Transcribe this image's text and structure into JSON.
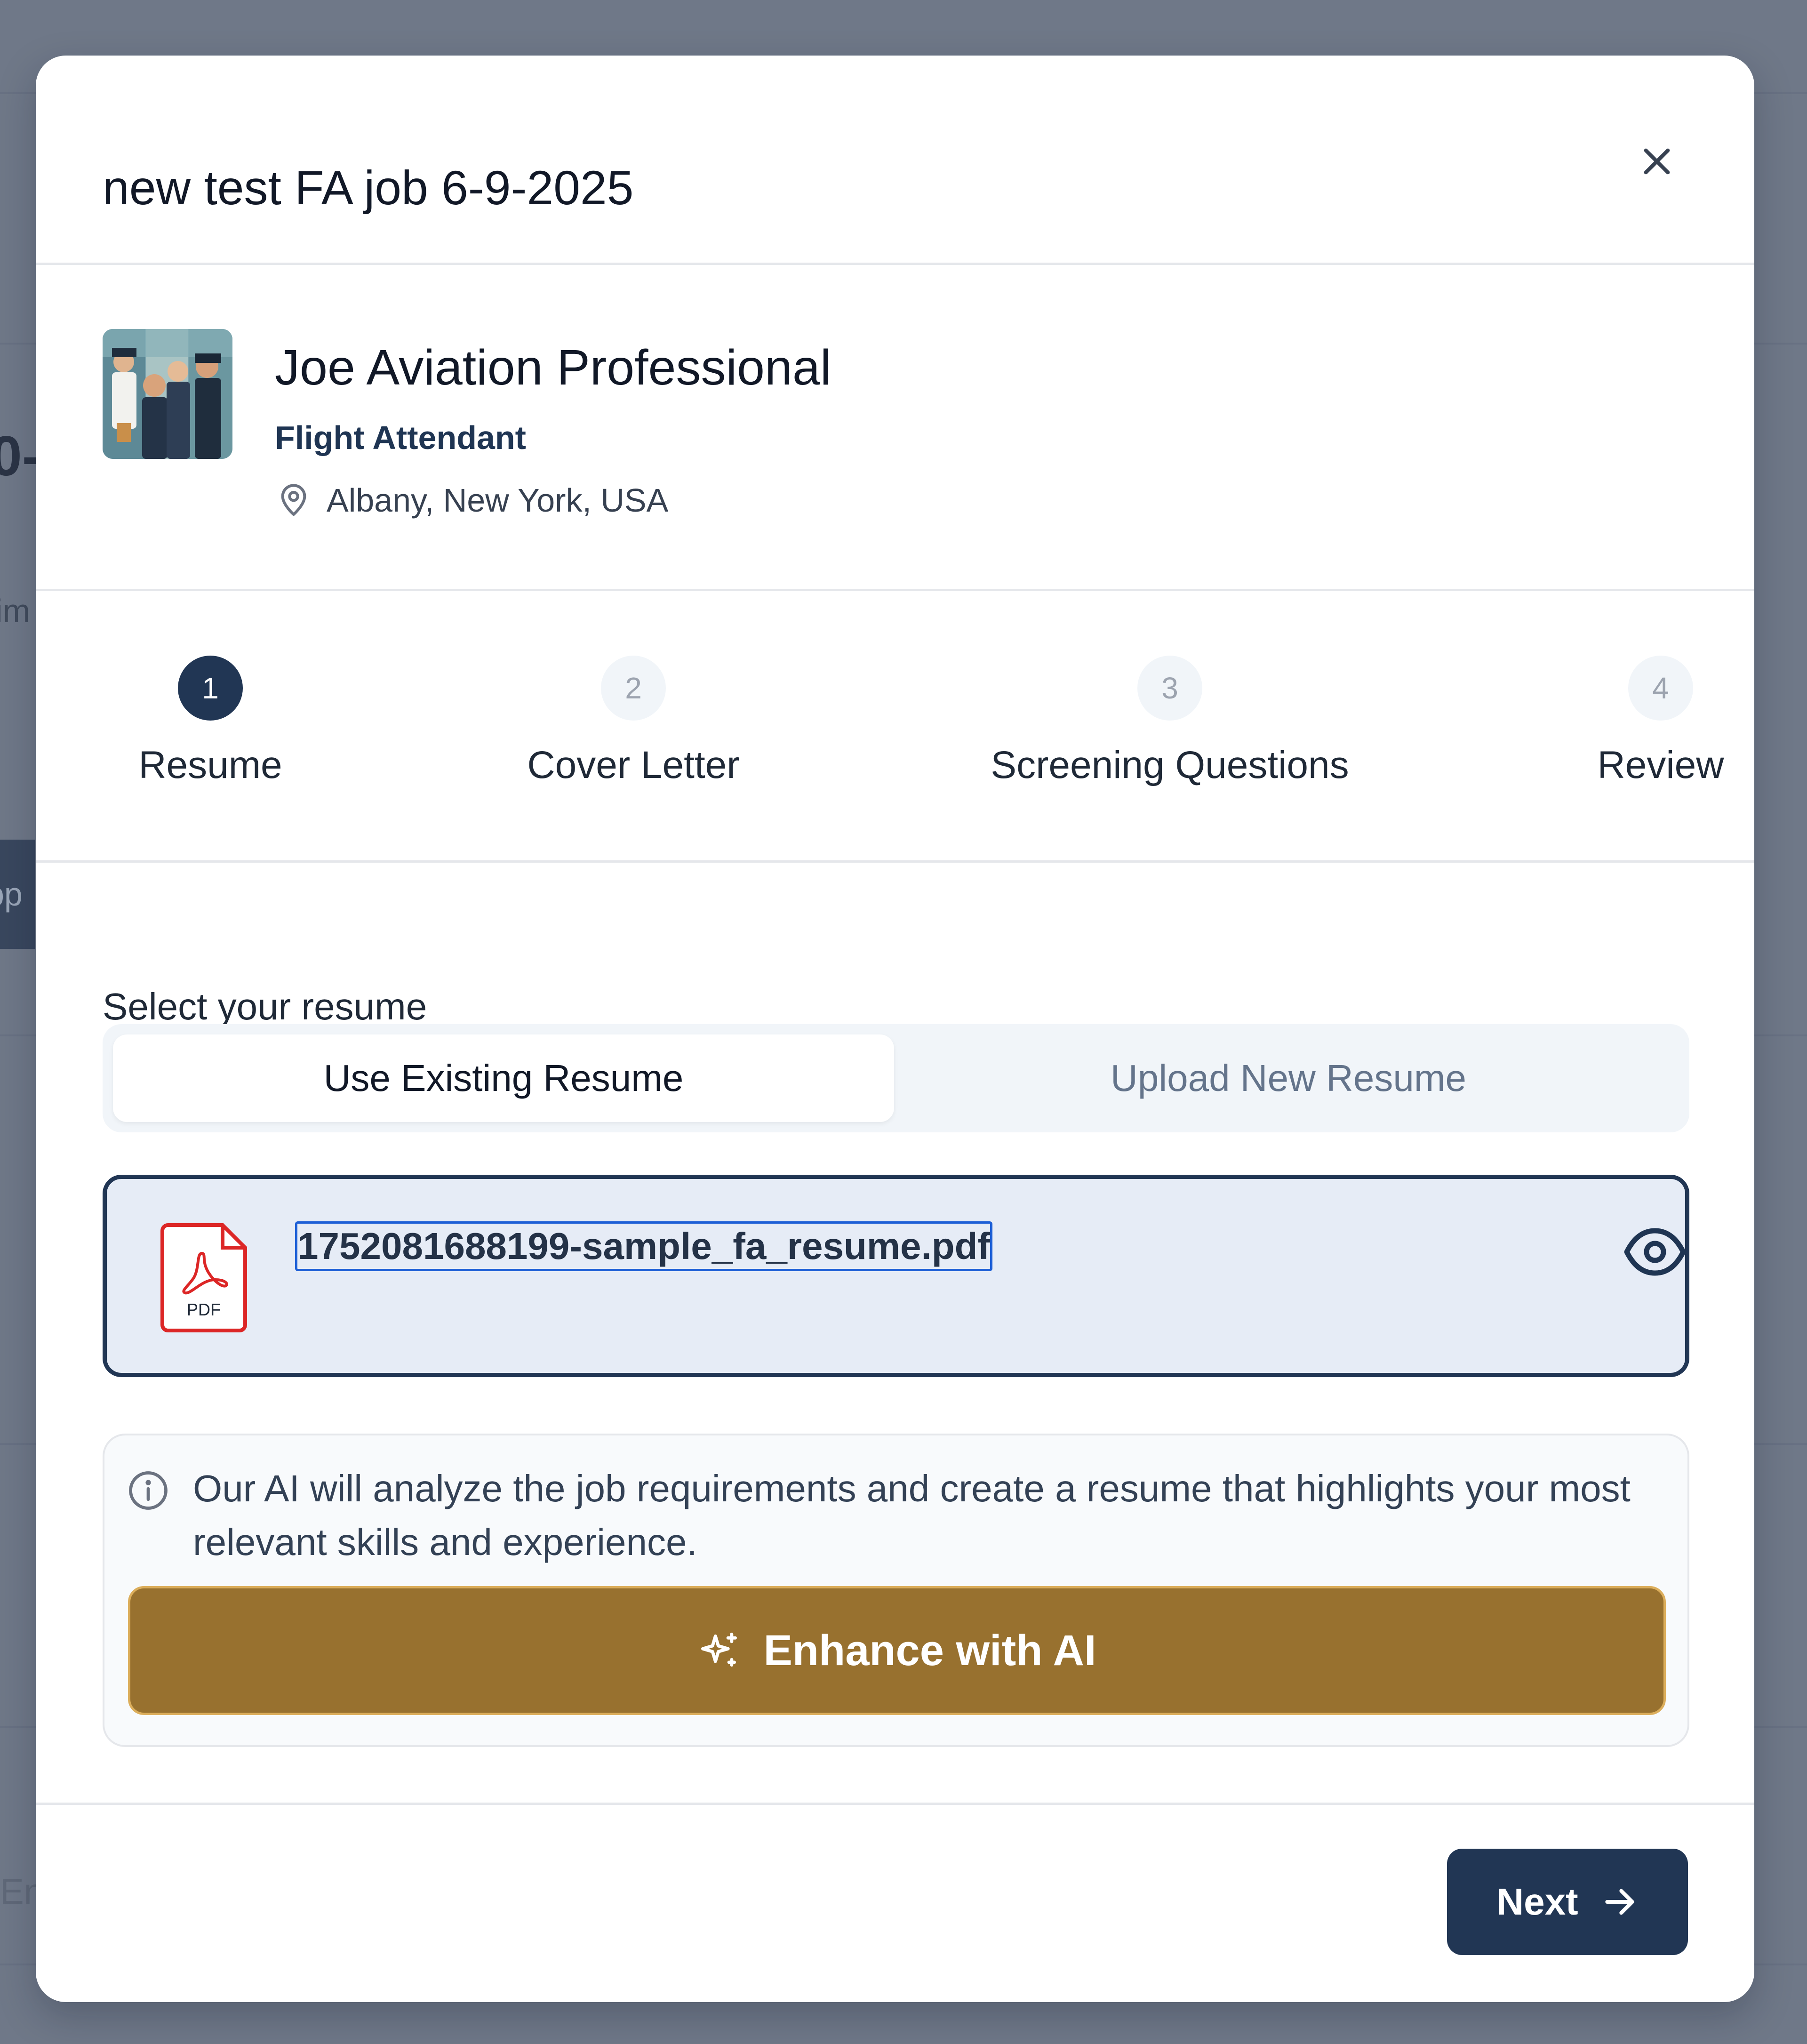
{
  "background": {
    "fragments": [
      "0-",
      "Tim",
      "pp",
      "En"
    ]
  },
  "modal": {
    "title": "new test FA job 6-9-2025",
    "close_icon": "close-icon"
  },
  "job": {
    "company_name": "Joe Aviation Professional",
    "job_title": "Flight Attendant",
    "location": "Albany, New York, USA",
    "location_icon": "map-pin-icon"
  },
  "stepper": {
    "steps": [
      {
        "number": "1",
        "label": "Resume",
        "active": true
      },
      {
        "number": "2",
        "label": "Cover Letter",
        "active": false
      },
      {
        "number": "3",
        "label": "Screening Questions",
        "active": false
      },
      {
        "number": "4",
        "label": "Review",
        "active": false
      }
    ]
  },
  "resume": {
    "section_label": "Select your resume",
    "tabs": [
      {
        "label": "Use Existing Resume",
        "selected": true
      },
      {
        "label": "Upload New Resume",
        "selected": false
      }
    ],
    "file": {
      "name": "1752081688199-sample_fa_resume.pdf",
      "icon_label": "PDF",
      "view_icon": "eye-icon"
    }
  },
  "ai": {
    "info_icon": "info-icon",
    "description": "Our AI will analyze the job requirements and create a resume that highlights your most relevant skills and experience.",
    "button_label": "Enhance with AI",
    "button_icon": "sparkles-icon"
  },
  "footer": {
    "next_label": "Next",
    "next_icon": "arrow-right-icon"
  },
  "colors": {
    "primary": "#213654",
    "accent_gold": "#98712f",
    "overlay": "#6f7888",
    "pdf_red": "#dc2626"
  }
}
